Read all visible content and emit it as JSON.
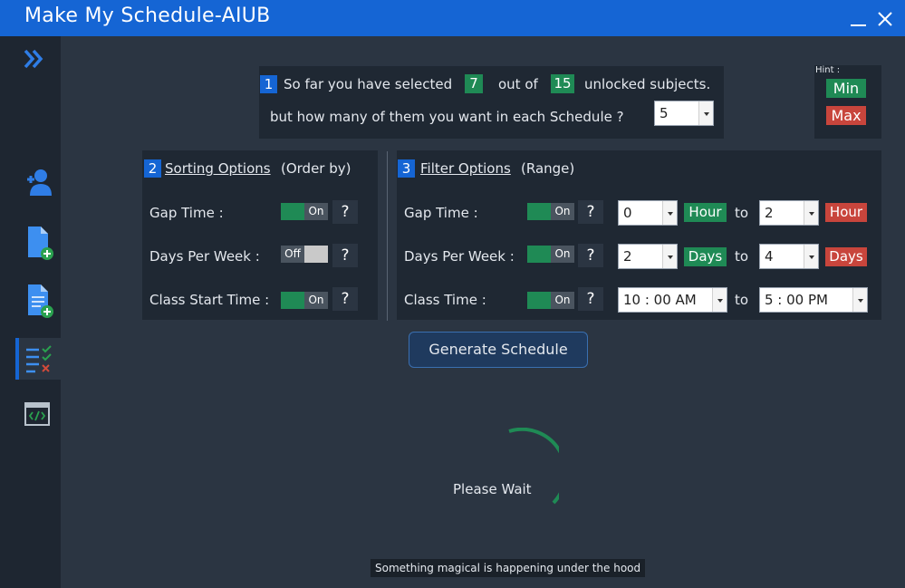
{
  "window": {
    "title": "Make My Schedule-AIUB",
    "minimize_glyph": "_",
    "close_glyph": "✕"
  },
  "sidebar": {
    "items": [
      {
        "icon": "double-chevron-right-icon"
      },
      {
        "icon": "add-user-icon"
      },
      {
        "icon": "new-document-icon"
      },
      {
        "icon": "add-document-icon"
      },
      {
        "icon": "checklist-icon",
        "active": true
      },
      {
        "icon": "code-window-icon"
      }
    ]
  },
  "selection": {
    "num": "1",
    "prefix": "So far you have selected",
    "selected_count": "7",
    "middle": "out of",
    "total_count": "15",
    "suffix": "unlocked subjects.",
    "question": "but how many of them you want in each Schedule ?",
    "per_schedule_value": "5"
  },
  "hint": {
    "label": "Hint :",
    "min": "Min",
    "max": "Max"
  },
  "sorting": {
    "num": "2",
    "title": "Sorting Options",
    "subtitle": "(Order by)",
    "rows": [
      {
        "label": "Gap Time :",
        "toggle": "On"
      },
      {
        "label": "Days Per Week :",
        "toggle": "Off"
      },
      {
        "label": "Class Start Time :",
        "toggle": "On"
      }
    ],
    "help": "?"
  },
  "filter": {
    "num": "3",
    "title": "Filter Options",
    "subtitle": "(Range)",
    "to": "to",
    "help": "?",
    "rows": [
      {
        "label": "Gap Time :",
        "toggle": "On",
        "min_value": "0",
        "min_unit": "Hour",
        "max_value": "2",
        "max_unit": "Hour"
      },
      {
        "label": "Days Per Week :",
        "toggle": "On",
        "min_value": "2",
        "min_unit": "Days",
        "max_value": "4",
        "max_unit": "Days"
      },
      {
        "label": "Class Time :",
        "toggle": "On",
        "min_value": "10 : 00 AM",
        "max_value": "5 : 00 PM"
      }
    ]
  },
  "actions": {
    "generate": "Generate Schedule"
  },
  "loading": {
    "text": "Please Wait",
    "note": "Something magical is happening under the hood"
  },
  "colors": {
    "accent": "#1565d4",
    "min_green": "#1f8a55",
    "max_red": "#c8453c",
    "background": "#2b3542"
  }
}
